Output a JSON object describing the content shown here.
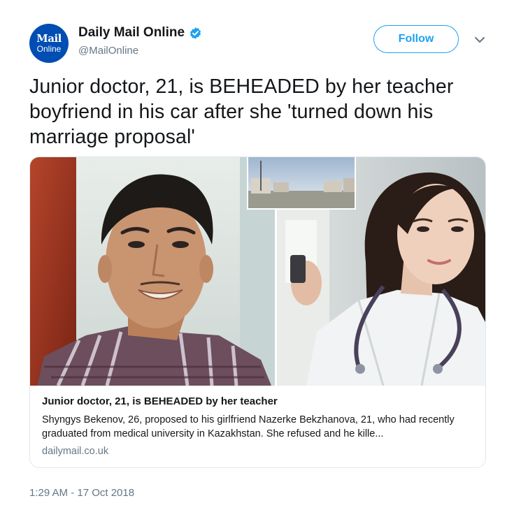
{
  "account": {
    "avatar_line1": "Mail",
    "avatar_line2": "Online",
    "display_name": "Daily Mail Online",
    "handle": "@MailOnline",
    "follow_label": "Follow"
  },
  "tweet": {
    "text": "Junior doctor, 21, is BEHEADED by her teacher boyfriend in his car after she 'turned down his marriage proposal'",
    "timestamp": "1:29 AM - 17 Oct 2018"
  },
  "card": {
    "title": "Junior doctor, 21, is BEHEADED by her teacher",
    "description": "Shyngys Bekenov, 26, proposed to his girlfriend Nazerke Bekzhanova, 21, who had recently graduated from medical university in Kazakhstan. She refused and he kille...",
    "domain": "dailymail.co.uk"
  },
  "colors": {
    "accent": "#1da1f2",
    "avatar_bg": "#004db3",
    "secondary_text": "#657786"
  },
  "icons": [
    "verified-badge-icon",
    "chevron-down-icon"
  ]
}
